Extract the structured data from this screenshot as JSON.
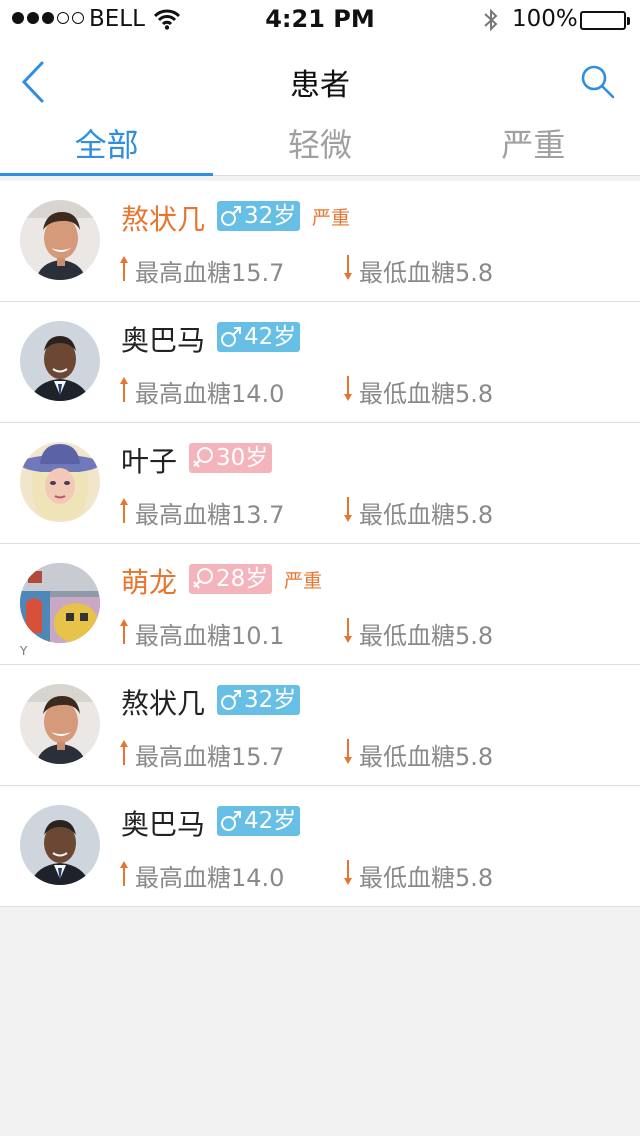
{
  "status_bar": {
    "carrier": "BELL",
    "time": "4:21 PM",
    "battery": "100%"
  },
  "nav": {
    "title": "患者"
  },
  "tabs": [
    {
      "label": "全部",
      "active": true
    },
    {
      "label": "轻微",
      "active": false
    },
    {
      "label": "严重",
      "active": false
    }
  ],
  "patients": [
    {
      "name": "熬状几",
      "gender": "male",
      "age": "32岁",
      "severity": "严重",
      "high": "最高血糖15.7",
      "low": "最低血糖5.8",
      "avatar": "man-smiling"
    },
    {
      "name": "奥巴马",
      "gender": "male",
      "age": "42岁",
      "severity": "",
      "high": "最高血糖14.0",
      "low": "最低血糖5.8",
      "avatar": "man-suit"
    },
    {
      "name": "叶子",
      "gender": "female",
      "age": "30岁",
      "severity": "",
      "high": "最高血糖13.7",
      "low": "最低血糖5.8",
      "avatar": "woman-hat"
    },
    {
      "name": "萌龙",
      "gender": "female",
      "age": "28岁",
      "severity": "严重",
      "high": "最高血糖10.1",
      "low": "最低血糖5.8",
      "avatar": "graffiti",
      "corner": "Y"
    },
    {
      "name": "熬状几",
      "gender": "male",
      "age": "32岁",
      "severity": "",
      "high": "最高血糖15.7",
      "low": "最低血糖5.8",
      "avatar": "man-smiling"
    },
    {
      "name": "奥巴马",
      "gender": "male",
      "age": "42岁",
      "severity": "",
      "high": "最高血糖14.0",
      "low": "最低血糖5.8",
      "avatar": "man-suit"
    }
  ],
  "colors": {
    "accent": "#2f8ee0",
    "severe": "#e8752f",
    "male_badge": "#67bfe6",
    "female_badge": "#f4b4bc"
  }
}
